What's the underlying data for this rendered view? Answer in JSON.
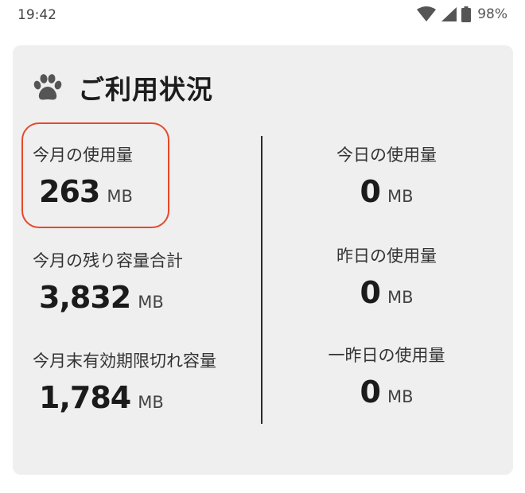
{
  "status_bar": {
    "time": "19:42",
    "battery_percent": "98%",
    "icons": [
      "wifi-icon",
      "signal-icon",
      "battery-icon"
    ]
  },
  "usage_card": {
    "title": "ご利用状況",
    "icon": "paw-icon",
    "highlight_color": "#e8482a",
    "left": [
      {
        "label": "今月の使用量",
        "value": "263",
        "unit": "MB"
      },
      {
        "label": "今月の残り容量合計",
        "value": "3,832",
        "unit": "MB"
      },
      {
        "label": "今月末有効期限切れ容量",
        "value": "1,784",
        "unit": "MB"
      }
    ],
    "right": [
      {
        "label": "今日の使用量",
        "value": "0",
        "unit": "MB"
      },
      {
        "label": "昨日の使用量",
        "value": "0",
        "unit": "MB"
      },
      {
        "label": "一昨日の使用量",
        "value": "0",
        "unit": "MB"
      }
    ]
  }
}
